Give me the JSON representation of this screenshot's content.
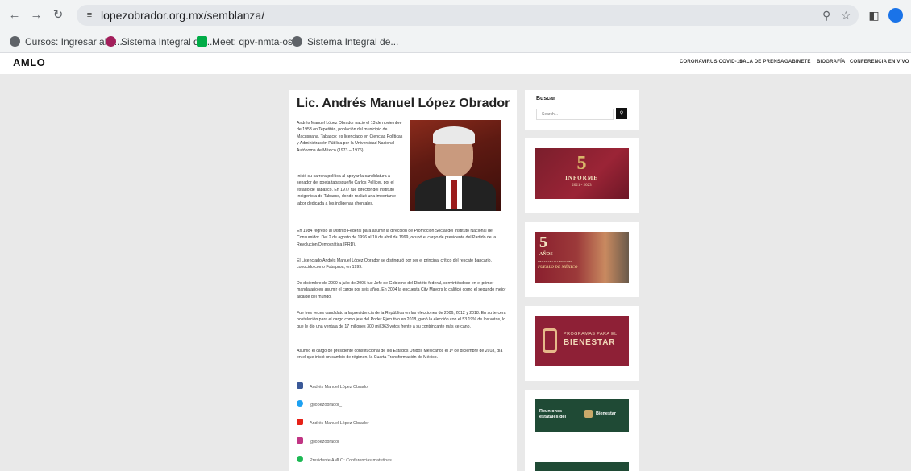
{
  "browser": {
    "url": "lopezobrador.org.mx/semblanza/",
    "bookmarks": [
      {
        "label": "Cursos: Ingresar al s...",
        "color": "#5f6368"
      },
      {
        "label": "Sistema Integral de...",
        "color": "#a21e5a"
      },
      {
        "label": "Meet: qpv-nmta-osh",
        "color": "#00ac47"
      },
      {
        "label": "Sistema Integral de...",
        "color": "#5f6368"
      }
    ]
  },
  "site": {
    "logo": "AMLO",
    "nav": [
      "CORONAVIRUS COVID-19",
      "SALA DE PRENSA",
      "GABINETE",
      "BIOGRAFÍA",
      "CONFERENCIA EN VIVO"
    ]
  },
  "article": {
    "title": "Lic. Andrés Manuel López Obrador",
    "paragraphs_short": [
      "Andrés Manuel López Obrador nació el 13 de noviembre de 1953 en Tepetitán, población del municipio de Macuspana, Tabasco; es licenciado en Ciencias Políticas y Administración Pública por la Universidad Nacional Autónoma de México (1973 – 1976).",
      "Inició su carrera política al apoyar la candidatura a senador del poeta tabasqueño Carlos Pellicer, por el estado de Tabasco. En 1977 fue director del Instituto Indigenista de Tabasco, donde realizó una importante labor dedicada a los indígenas chontales."
    ],
    "paragraphs": [
      "En 1984 regresó al Distrito Federal para asumir la dirección de Promoción Social del Instituto Nacional del Consumidor. Del 2 de agosto de 1996 al 10 de abril de 1999, ocupó el cargo de presidente del Partido de la Revolución Democrática (PRD).",
      "El Licenciado Andrés Manuel López Obrador se distinguió por ser el principal crítico del rescate bancario, conocido como Fobaproa, en 1999.",
      "De diciembre de 2000 a julio de 2005 fue Jefe de Gobierno del Distrito federal, convirtiéndose en el primer mandatario en asumir el cargo por seis años. En 2004 la encuesta City Mayors lo calificó como el segundo mejor alcalde del mundo.",
      "Fue tres veces candidato a la presidencia de la República en las elecciones de 2006, 2012 y 2018. En su tercera postulación para el cargo como jefe del Poder Ejecutivo en 2018, ganó la elección con el 53.19% de los votos, lo que le dio una ventaja de 17 millones 300 mil 363 votos frente a su contrincante más cercano.",
      "Asumió el cargo de presidente constitucional de los Estados Unidos Mexicanos el 1º de diciembre de 2018, día en el que inició un cambio de régimen, la Cuarta Transformación de México."
    ],
    "social": [
      {
        "label": "Andrés Manuel López Obrador",
        "icon": "facebook-icon",
        "color": "#3b5998"
      },
      {
        "label": "@lopezobrador_",
        "icon": "twitter-icon",
        "color": "#1da1f2"
      },
      {
        "label": "Andrés Manuel López Obrador",
        "icon": "youtube-icon",
        "color": "#e62117"
      },
      {
        "label": "@lopezobrador",
        "icon": "instagram-icon",
        "color": "#c13584"
      },
      {
        "label": "Presidente AMLO: Conferencias matutinas",
        "icon": "spotify-icon",
        "color": "#1db954"
      }
    ]
  },
  "sidebar": {
    "search_title": "Buscar",
    "search_placeholder": "Search...",
    "banner1": {
      "number": "5",
      "title": "INFORME",
      "years": "2021 - 2023"
    },
    "banner2": {
      "number": "5",
      "word": "AÑOS",
      "subtitle": "DEL TRABAJO UNIDO DEL",
      "tail": "PUEBLO DE MÉXICO"
    },
    "banner3": {
      "line1": "PROGRAMAS PARA EL",
      "line2": "BIENESTAR"
    },
    "banner4": {
      "line1": "Reuniones",
      "line2": "estatales del",
      "brand": "Bienestar"
    }
  }
}
